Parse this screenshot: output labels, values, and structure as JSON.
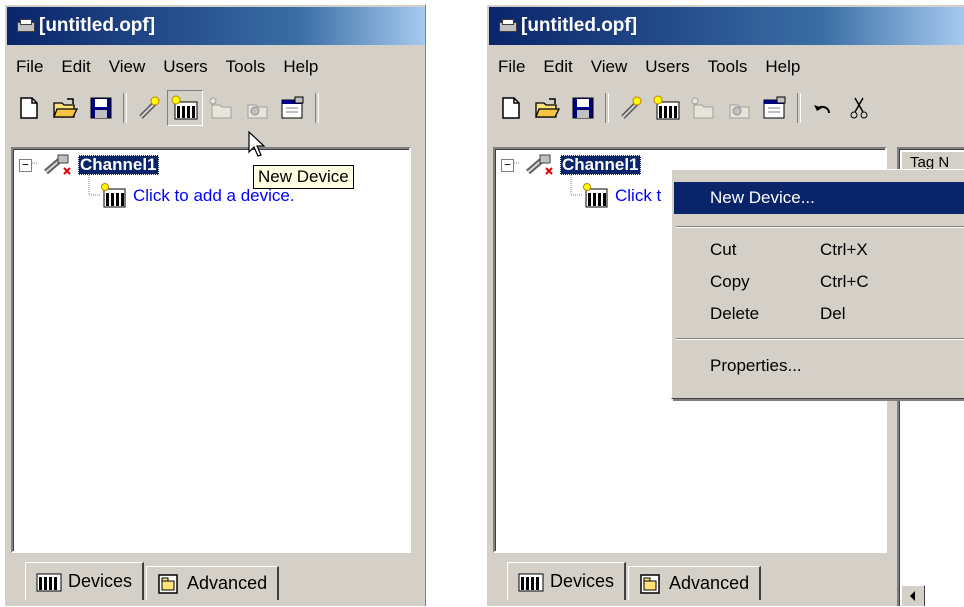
{
  "left_window": {
    "title": "[untitled.opf]",
    "menu": [
      "File",
      "Edit",
      "View",
      "Users",
      "Tools",
      "Help"
    ],
    "tree": {
      "channel": "Channel1",
      "add_device": "Click to add a device."
    },
    "tooltip": "New Device",
    "tabs": [
      "Devices",
      "Advanced"
    ]
  },
  "right_window": {
    "title": "[untitled.opf]",
    "menu": [
      "File",
      "Edit",
      "View",
      "Users",
      "Tools",
      "Help"
    ],
    "tree": {
      "channel": "Channel1",
      "add_device_partial": "Click t"
    },
    "column_header": "Tag N",
    "tabs": [
      "Devices",
      "Advanced"
    ],
    "context_menu": {
      "new_device": "New Device...",
      "cut": "Cut",
      "cut_shortcut": "Ctrl+X",
      "copy": "Copy",
      "copy_shortcut": "Ctrl+C",
      "delete": "Delete",
      "delete_shortcut": "Del",
      "properties": "Properties..."
    }
  },
  "colors": {
    "titlebar_start": "#0a246a",
    "selection": "#0a246a",
    "face": "#d4d0c8",
    "link": "#0000ff",
    "tooltip_bg": "#ffffe1"
  },
  "icons": [
    "app-icon",
    "new-file-icon",
    "open-folder-icon",
    "save-icon",
    "new-channel-icon",
    "new-device-icon",
    "new-group-icon",
    "new-tag-icon",
    "properties-icon",
    "undo-icon",
    "cut-icon",
    "channel-icon",
    "device-icon",
    "advanced-tab-icon",
    "scroll-left-icon"
  ]
}
